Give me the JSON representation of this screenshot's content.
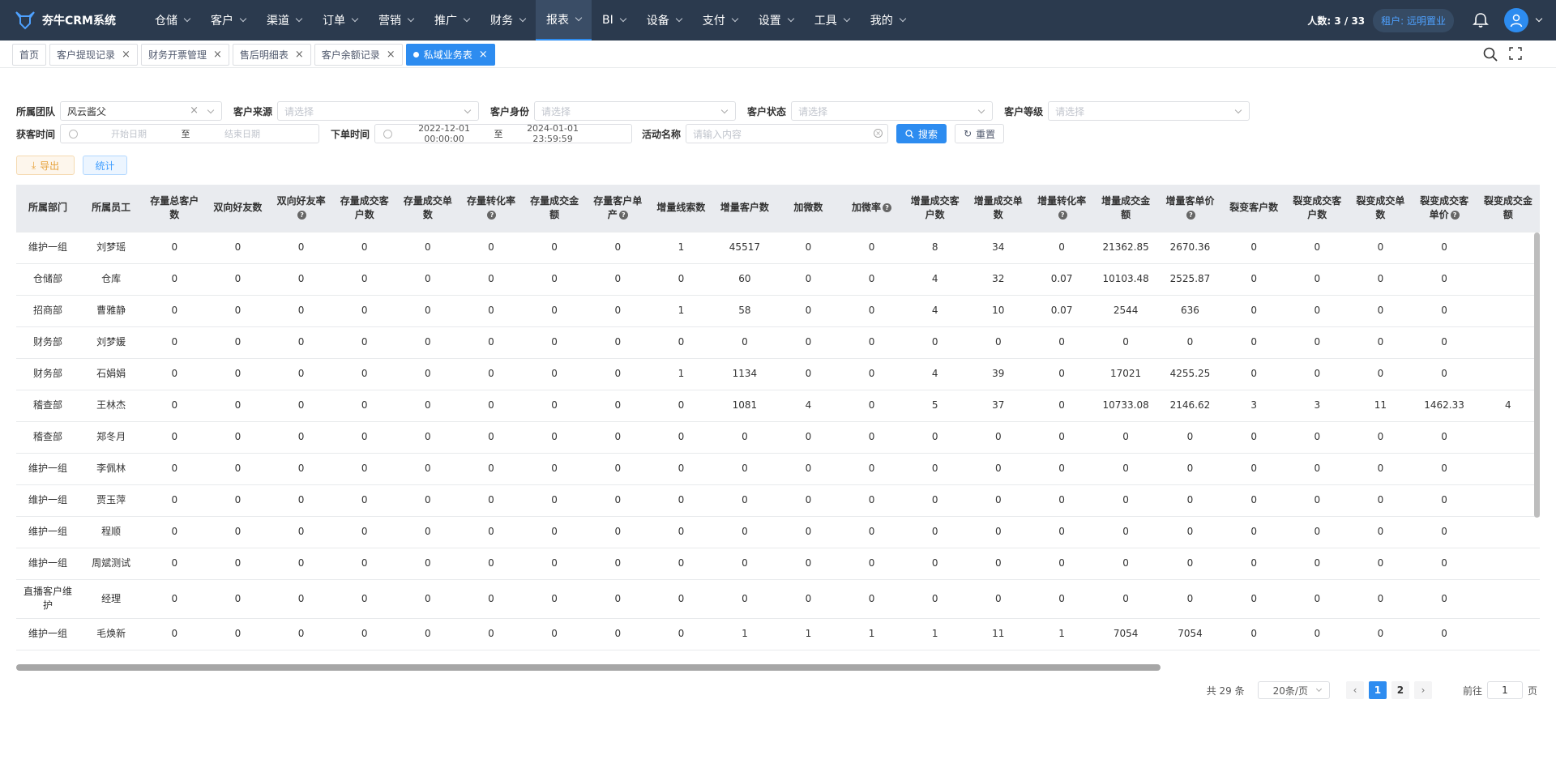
{
  "app": {
    "title": "夯牛CRM系统"
  },
  "nav": [
    {
      "label": "仓储",
      "active": false
    },
    {
      "label": "客户",
      "active": false
    },
    {
      "label": "渠道",
      "active": false
    },
    {
      "label": "订单",
      "active": false
    },
    {
      "label": "营销",
      "active": false
    },
    {
      "label": "推广",
      "active": false
    },
    {
      "label": "财务",
      "active": false
    },
    {
      "label": "报表",
      "active": true
    },
    {
      "label": "BI",
      "active": false
    },
    {
      "label": "设备",
      "active": false
    },
    {
      "label": "支付",
      "active": false
    },
    {
      "label": "设置",
      "active": false
    },
    {
      "label": "工具",
      "active": false
    },
    {
      "label": "我的",
      "active": false
    }
  ],
  "header": {
    "user_count": "人数: 3 / 33",
    "tenant": "租户: 远明置业"
  },
  "tabs": [
    {
      "label": "首页",
      "closable": false,
      "active": false
    },
    {
      "label": "客户提现记录",
      "closable": true,
      "active": false
    },
    {
      "label": "财务开票管理",
      "closable": true,
      "active": false
    },
    {
      "label": "售后明细表",
      "closable": true,
      "active": false
    },
    {
      "label": "客户余额记录",
      "closable": true,
      "active": false
    },
    {
      "label": "私域业务表",
      "closable": true,
      "active": true
    }
  ],
  "filters": {
    "team_label": "所属团队",
    "team_value": "风云酱父",
    "source_label": "客户来源",
    "source_placeholder": "请选择",
    "identity_label": "客户身份",
    "identity_placeholder": "请选择",
    "status_label": "客户状态",
    "status_placeholder": "请选择",
    "level_label": "客户等级",
    "level_placeholder": "请选择",
    "acquire_label": "获客时间",
    "acquire_start": "开始日期",
    "acquire_sep": "至",
    "acquire_end": "结束日期",
    "order_label": "下单时间",
    "order_start": "2022-12-01 00:00:00",
    "order_sep": "至",
    "order_end": "2024-01-01 23:59:59",
    "activity_label": "活动名称",
    "activity_placeholder": "请输入内容",
    "search_button": "搜索",
    "reset_button": "重置",
    "export_button": "导出",
    "stat_button": "统计"
  },
  "table": {
    "columns": [
      {
        "label": "所属部门",
        "help": false
      },
      {
        "label": "所属员工",
        "help": false
      },
      {
        "label": "存量总客户数",
        "help": false
      },
      {
        "label": "双向好友数",
        "help": false
      },
      {
        "label": "双向好友率",
        "help": true
      },
      {
        "label": "存量成交客户数",
        "help": false
      },
      {
        "label": "存量成交单数",
        "help": false
      },
      {
        "label": "存量转化率",
        "help": true
      },
      {
        "label": "存量成交金额",
        "help": false
      },
      {
        "label": "存量客户单产",
        "help": true
      },
      {
        "label": "增量线索数",
        "help": false
      },
      {
        "label": "增量客户数",
        "help": false
      },
      {
        "label": "加微数",
        "help": false
      },
      {
        "label": "加微率",
        "help": true
      },
      {
        "label": "增量成交客户数",
        "help": false
      },
      {
        "label": "增量成交单数",
        "help": false
      },
      {
        "label": "增量转化率",
        "help": true
      },
      {
        "label": "增量成交金额",
        "help": false
      },
      {
        "label": "增量客单价",
        "help": true
      },
      {
        "label": "裂变客户数",
        "help": false
      },
      {
        "label": "裂变成交客户数",
        "help": false
      },
      {
        "label": "裂变成交单数",
        "help": false
      },
      {
        "label": "裂变成交客单价",
        "help": true
      },
      {
        "label": "裂变成交金额",
        "help": false
      }
    ],
    "rows": [
      [
        "维护一组",
        "刘梦瑶",
        "0",
        "0",
        "0",
        "0",
        "0",
        "0",
        "0",
        "0",
        "1",
        "45517",
        "0",
        "0",
        "8",
        "34",
        "0",
        "21362.85",
        "2670.36",
        "0",
        "0",
        "0",
        "0",
        ""
      ],
      [
        "仓储部",
        "仓库",
        "0",
        "0",
        "0",
        "0",
        "0",
        "0",
        "0",
        "0",
        "0",
        "60",
        "0",
        "0",
        "4",
        "32",
        "0.07",
        "10103.48",
        "2525.87",
        "0",
        "0",
        "0",
        "0",
        ""
      ],
      [
        "招商部",
        "曹雅静",
        "0",
        "0",
        "0",
        "0",
        "0",
        "0",
        "0",
        "0",
        "1",
        "58",
        "0",
        "0",
        "4",
        "10",
        "0.07",
        "2544",
        "636",
        "0",
        "0",
        "0",
        "0",
        ""
      ],
      [
        "财务部",
        "刘梦媛",
        "0",
        "0",
        "0",
        "0",
        "0",
        "0",
        "0",
        "0",
        "0",
        "0",
        "0",
        "0",
        "0",
        "0",
        "0",
        "0",
        "0",
        "0",
        "0",
        "0",
        "0",
        ""
      ],
      [
        "财务部",
        "石娟娟",
        "0",
        "0",
        "0",
        "0",
        "0",
        "0",
        "0",
        "0",
        "1",
        "1134",
        "0",
        "0",
        "4",
        "39",
        "0",
        "17021",
        "4255.25",
        "0",
        "0",
        "0",
        "0",
        ""
      ],
      [
        "稽查部",
        "王林杰",
        "0",
        "0",
        "0",
        "0",
        "0",
        "0",
        "0",
        "0",
        "0",
        "1081",
        "4",
        "0",
        "5",
        "37",
        "0",
        "10733.08",
        "2146.62",
        "3",
        "3",
        "11",
        "1462.33",
        "4"
      ],
      [
        "稽查部",
        "郑冬月",
        "0",
        "0",
        "0",
        "0",
        "0",
        "0",
        "0",
        "0",
        "0",
        "0",
        "0",
        "0",
        "0",
        "0",
        "0",
        "0",
        "0",
        "0",
        "0",
        "0",
        "0",
        ""
      ],
      [
        "维护一组",
        "李佩林",
        "0",
        "0",
        "0",
        "0",
        "0",
        "0",
        "0",
        "0",
        "0",
        "0",
        "0",
        "0",
        "0",
        "0",
        "0",
        "0",
        "0",
        "0",
        "0",
        "0",
        "0",
        ""
      ],
      [
        "维护一组",
        "贾玉萍",
        "0",
        "0",
        "0",
        "0",
        "0",
        "0",
        "0",
        "0",
        "0",
        "0",
        "0",
        "0",
        "0",
        "0",
        "0",
        "0",
        "0",
        "0",
        "0",
        "0",
        "0",
        ""
      ],
      [
        "维护一组",
        "程顺",
        "0",
        "0",
        "0",
        "0",
        "0",
        "0",
        "0",
        "0",
        "0",
        "0",
        "0",
        "0",
        "0",
        "0",
        "0",
        "0",
        "0",
        "0",
        "0",
        "0",
        "0",
        ""
      ],
      [
        "维护一组",
        "周斌测试",
        "0",
        "0",
        "0",
        "0",
        "0",
        "0",
        "0",
        "0",
        "0",
        "0",
        "0",
        "0",
        "0",
        "0",
        "0",
        "0",
        "0",
        "0",
        "0",
        "0",
        "0",
        ""
      ],
      [
        "直播客户维护",
        "经理",
        "0",
        "0",
        "0",
        "0",
        "0",
        "0",
        "0",
        "0",
        "0",
        "0",
        "0",
        "0",
        "0",
        "0",
        "0",
        "0",
        "0",
        "0",
        "0",
        "0",
        "0",
        ""
      ],
      [
        "维护一组",
        "毛焕新",
        "0",
        "0",
        "0",
        "0",
        "0",
        "0",
        "0",
        "0",
        "0",
        "1",
        "1",
        "1",
        "1",
        "11",
        "1",
        "7054",
        "7054",
        "0",
        "0",
        "0",
        "0",
        ""
      ]
    ]
  },
  "pagination": {
    "total": "共 29 条",
    "page_size": "20条/页",
    "pages": [
      "1",
      "2"
    ],
    "current": "1",
    "goto_label": "前往",
    "goto_value": "1",
    "goto_suffix": "页"
  }
}
